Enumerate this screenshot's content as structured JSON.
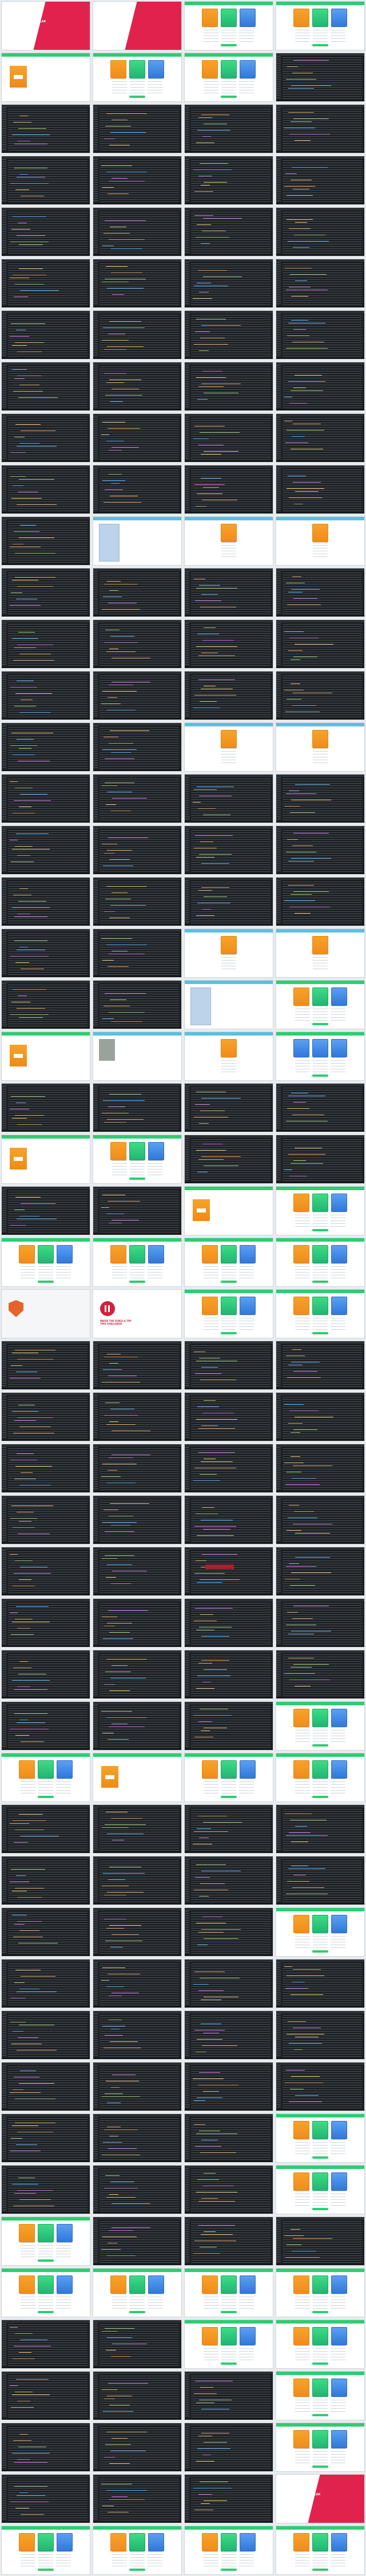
{
  "screen": {
    "kind": "contact-sheet",
    "columns": 4,
    "frame_count": 200
  },
  "promos": {
    "intro_title": "ANGULAR 2 ANGULAR BEGINNERS",
    "intro_subtitle": "",
    "pause_title": "PAUSE THE VIDEO & TRY THIS CHALLENGE",
    "closing_title": "ANGULAR 2 ANGULAR BEGINNERS"
  },
  "colors": {
    "editor_bg": "#1e2124",
    "accent_orange": "#f08c1b",
    "accent_green": "#22b573",
    "accent_blue": "#3178d9",
    "promo_red": "#e0224c"
  },
  "icons": {
    "play_pause": "pause-icon",
    "brand": "shield-logo-icon"
  }
}
